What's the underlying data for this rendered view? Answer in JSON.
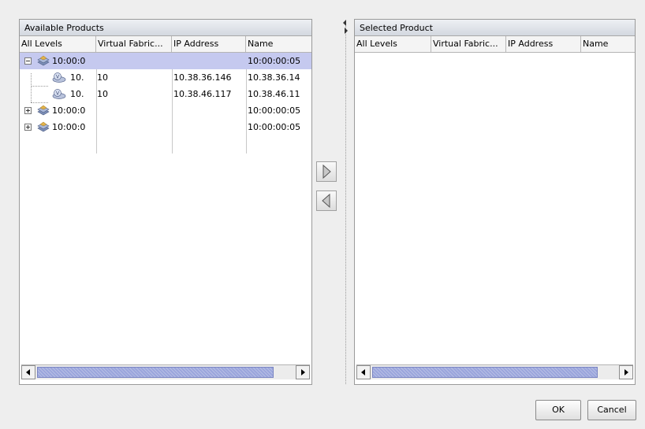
{
  "available_panel": {
    "title": "Available Products",
    "columns": [
      "All Levels",
      "Virtual Fabric...",
      "IP Address",
      "Name"
    ],
    "rows": [
      {
        "level": "10:00:0",
        "vfid": "",
        "ip": "",
        "name": "10:00:00:05",
        "selected": true,
        "depth": 0,
        "expander": "minus",
        "icon": "switch-group-icon"
      },
      {
        "level": "10.",
        "vfid": "10",
        "ip": "10.38.36.146",
        "name": "10.38.36.14",
        "selected": false,
        "depth": 1,
        "expander": "",
        "icon": "virtual-switch-icon"
      },
      {
        "level": "10.",
        "vfid": "10",
        "ip": "10.38.46.117",
        "name": "10.38.46.11",
        "selected": false,
        "depth": 1,
        "expander": "",
        "icon": "virtual-switch-icon"
      },
      {
        "level": "10:00:0",
        "vfid": "",
        "ip": "",
        "name": "10:00:00:05",
        "selected": false,
        "depth": 0,
        "expander": "plus",
        "icon": "switch-group-icon"
      },
      {
        "level": "10:00:0",
        "vfid": "",
        "ip": "",
        "name": "10:00:00:05",
        "selected": false,
        "depth": 0,
        "expander": "plus",
        "icon": "switch-group-icon"
      }
    ]
  },
  "selected_panel": {
    "title": "Selected Product",
    "columns": [
      "All Levels",
      "Virtual Fabric...",
      "IP Address",
      "Name"
    ],
    "rows": []
  },
  "transfer": {
    "add_icon": "arrow-right-icon",
    "remove_icon": "arrow-left-icon"
  },
  "footer": {
    "ok_label": "OK",
    "cancel_label": "Cancel"
  },
  "colors": {
    "selection": "#c5c9ef",
    "scroll_thumb": "#9aa5dc"
  }
}
